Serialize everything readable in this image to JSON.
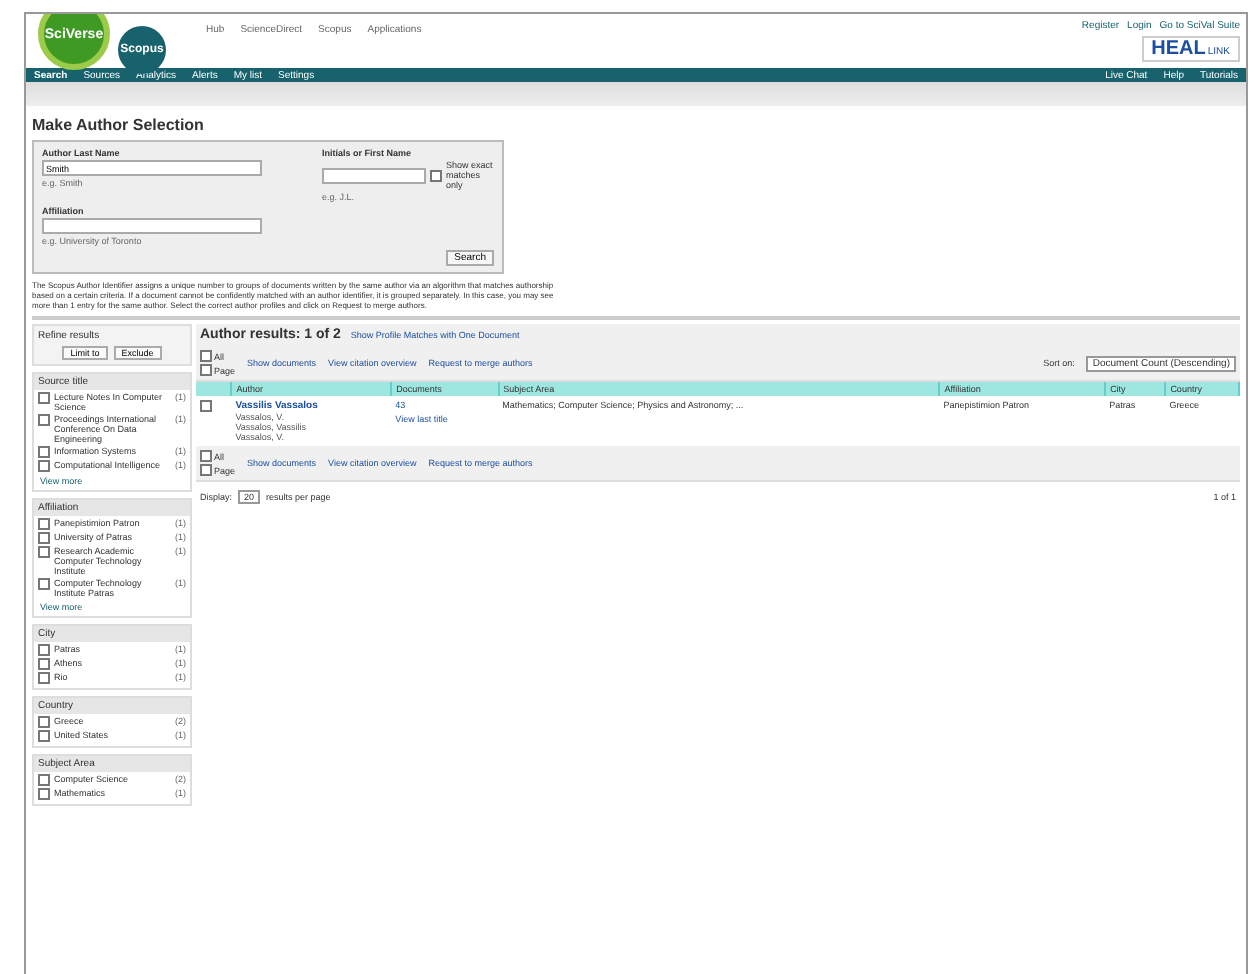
{
  "header": {
    "logo_main": "SciVerse",
    "logo_sub": "Scopus",
    "top_links": [
      "Hub",
      "ScienceDirect",
      "Scopus",
      "Applications"
    ],
    "user_links": [
      "Register",
      "Login",
      "Go to SciVal Suite"
    ],
    "partner_logo": "HEAL",
    "partner_sub": "LINK",
    "nav": [
      {
        "label": "Search",
        "selected": true
      },
      {
        "label": "Sources",
        "selected": false
      },
      {
        "label": "Analytics",
        "selected": false
      },
      {
        "label": "Alerts",
        "selected": false
      },
      {
        "label": "My list",
        "selected": false
      },
      {
        "label": "Settings",
        "selected": false
      }
    ],
    "nav_right": [
      "Live Chat",
      "Help",
      "Tutorials"
    ]
  },
  "page_title": "Make Author Selection",
  "form": {
    "fields": [
      {
        "label": "Author Last Name",
        "value": "Smith",
        "hint": "e.g. Smith"
      },
      {
        "label": "Initials or First Name",
        "hint": "e.g. J.L."
      },
      {
        "label": "Affiliation",
        "hint": "e.g. University of Toronto"
      }
    ],
    "exact": {
      "label": "Show exact matches only",
      "checked": false
    },
    "button": "Search"
  },
  "notice": "The Scopus Author Identifier assigns a unique number to groups of documents written by the same author via an algorithm that matches authorship based on a certain criteria. If a document cannot be confidently matched with an author identifier, it is grouped separately. In this case, you may see more than 1 entry for the same author. Select the correct author profiles and click on Request to merge authors.",
  "sidebar": {
    "title": "Refine results",
    "buttons": [
      "Limit to",
      "Exclude"
    ],
    "sections": [
      {
        "title": "Source title",
        "items": [
          {
            "label": "Lecture Notes In Computer Science",
            "count": "(1)",
            "checked": false
          },
          {
            "label": "Proceedings International Conference On Data Engineering",
            "count": "(1)",
            "checked": false
          },
          {
            "label": "Information Systems",
            "count": "(1)",
            "checked": false
          },
          {
            "label": "Computational Intelligence",
            "count": "(1)",
            "checked": false
          }
        ],
        "more": "View more"
      },
      {
        "title": "Affiliation",
        "items": [
          {
            "label": "Panepistimion Patron",
            "count": "(1)",
            "checked": false
          },
          {
            "label": "University of Patras",
            "count": "(1)",
            "checked": false
          },
          {
            "label": "Research Academic Computer Technology Institute",
            "count": "(1)",
            "checked": false
          },
          {
            "label": "Computer Technology Institute Patras",
            "count": "(1)",
            "checked": false
          }
        ],
        "more": "View more"
      },
      {
        "title": "City",
        "items": [
          {
            "label": "Patras",
            "count": "(1)",
            "checked": false
          },
          {
            "label": "Athens",
            "count": "(1)",
            "checked": false
          },
          {
            "label": "Rio",
            "count": "(1)",
            "checked": false
          }
        ]
      },
      {
        "title": "Country",
        "items": [
          {
            "label": "Greece",
            "count": "(2)",
            "checked": false
          },
          {
            "label": "United States",
            "count": "(1)",
            "checked": false
          }
        ]
      },
      {
        "title": "Subject Area",
        "items": [
          {
            "label": "Computer Science",
            "count": "(2)",
            "checked": false
          },
          {
            "label": "Mathematics",
            "count": "(1)",
            "checked": false
          }
        ]
      }
    ]
  },
  "results": {
    "title": "Author results: 1 of 2",
    "link": "Show Profile Matches with One Document",
    "toolbars": [
      {
        "select_all": {
          "label": "All",
          "checked": false
        },
        "select_page": {
          "label": "Page",
          "checked": false
        },
        "actions": [
          "Show documents",
          "View citation overview",
          "Request to merge authors"
        ]
      },
      {
        "select_all": {
          "label": "All",
          "checked": false
        },
        "select_page": {
          "label": "Page",
          "checked": false
        },
        "actions": [
          "Show documents",
          "View citation overview",
          "Request to merge authors"
        ]
      }
    ],
    "sort": {
      "label": "Sort on:",
      "value": "Document Count (Descending)"
    },
    "columns": [
      "Author",
      "Documents",
      "Subject Area",
      "Affiliation",
      "City",
      "Country"
    ],
    "rows": [
      {
        "checked": false,
        "author": "Vassilis Vassalos",
        "variants": [
          "Vassalos, V.",
          "Vassalos, Vassilis",
          "Vassalos, V."
        ],
        "documents": "43",
        "view_last": "View last title",
        "subject": "Mathematics; Computer Science; Physics and Astronomy; ...",
        "affiliation": "Panepistimion Patron",
        "city": "Patras",
        "country": "Greece"
      }
    ],
    "display": {
      "label": "Display:",
      "value": "20",
      "suffix": "results per page"
    },
    "pages": "1 of 1"
  }
}
